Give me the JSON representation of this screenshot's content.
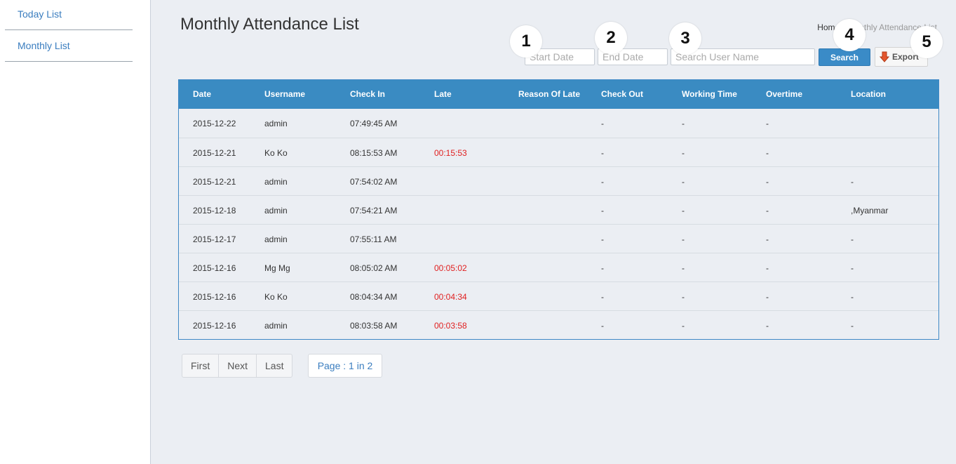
{
  "sidebar": {
    "items": [
      {
        "label": "Today List"
      },
      {
        "label": "Monthly List"
      }
    ]
  },
  "header": {
    "title": "Monthly Attendance List",
    "breadcrumb": {
      "home": "Home",
      "current": "Monthly Attendance List"
    }
  },
  "filters": {
    "start_placeholder": "Start Date",
    "end_placeholder": "End Date",
    "user_placeholder": "Search User Name",
    "search_label": "Search",
    "export_label": "Export"
  },
  "callouts": [
    "1",
    "2",
    "3",
    "4",
    "5"
  ],
  "table": {
    "columns": [
      "Date",
      "Username",
      "Check In",
      "Late",
      "Reason Of Late",
      "Check Out",
      "Working Time",
      "Overtime",
      "Location"
    ],
    "rows": [
      {
        "date": "2015-12-22",
        "user": "admin",
        "in": "07:49:45 AM",
        "late": "",
        "reason": "",
        "out": "-",
        "work": "-",
        "over": "-",
        "loc": ""
      },
      {
        "date": "2015-12-21",
        "user": "Ko Ko",
        "in": "08:15:53 AM",
        "late": "00:15:53",
        "reason": "",
        "out": "-",
        "work": "-",
        "over": "-",
        "loc": ""
      },
      {
        "date": "2015-12-21",
        "user": "admin",
        "in": "07:54:02 AM",
        "late": "",
        "reason": "",
        "out": "-",
        "work": "-",
        "over": "-",
        "loc": "-"
      },
      {
        "date": "2015-12-18",
        "user": "admin",
        "in": "07:54:21 AM",
        "late": "",
        "reason": "",
        "out": "-",
        "work": "-",
        "over": "-",
        "loc": ",Myanmar"
      },
      {
        "date": "2015-12-17",
        "user": "admin",
        "in": "07:55:11 AM",
        "late": "",
        "reason": "",
        "out": "-",
        "work": "-",
        "over": "-",
        "loc": "-"
      },
      {
        "date": "2015-12-16",
        "user": "Mg Mg",
        "in": "08:05:02 AM",
        "late": "00:05:02",
        "reason": "",
        "out": "-",
        "work": "-",
        "over": "-",
        "loc": "-"
      },
      {
        "date": "2015-12-16",
        "user": "Ko Ko",
        "in": "08:04:34 AM",
        "late": "00:04:34",
        "reason": "",
        "out": "-",
        "work": "-",
        "over": "-",
        "loc": "-"
      },
      {
        "date": "2015-12-16",
        "user": "admin",
        "in": "08:03:58 AM",
        "late": "00:03:58",
        "reason": "",
        "out": "-",
        "work": "-",
        "over": "-",
        "loc": "-"
      }
    ]
  },
  "pagination": {
    "first": "First",
    "next": "Next",
    "last": "Last",
    "info": "Page : 1 in 2"
  },
  "colors": {
    "accent": "#3a8bc2",
    "late": "#e02020",
    "link": "#3a7dbf"
  }
}
